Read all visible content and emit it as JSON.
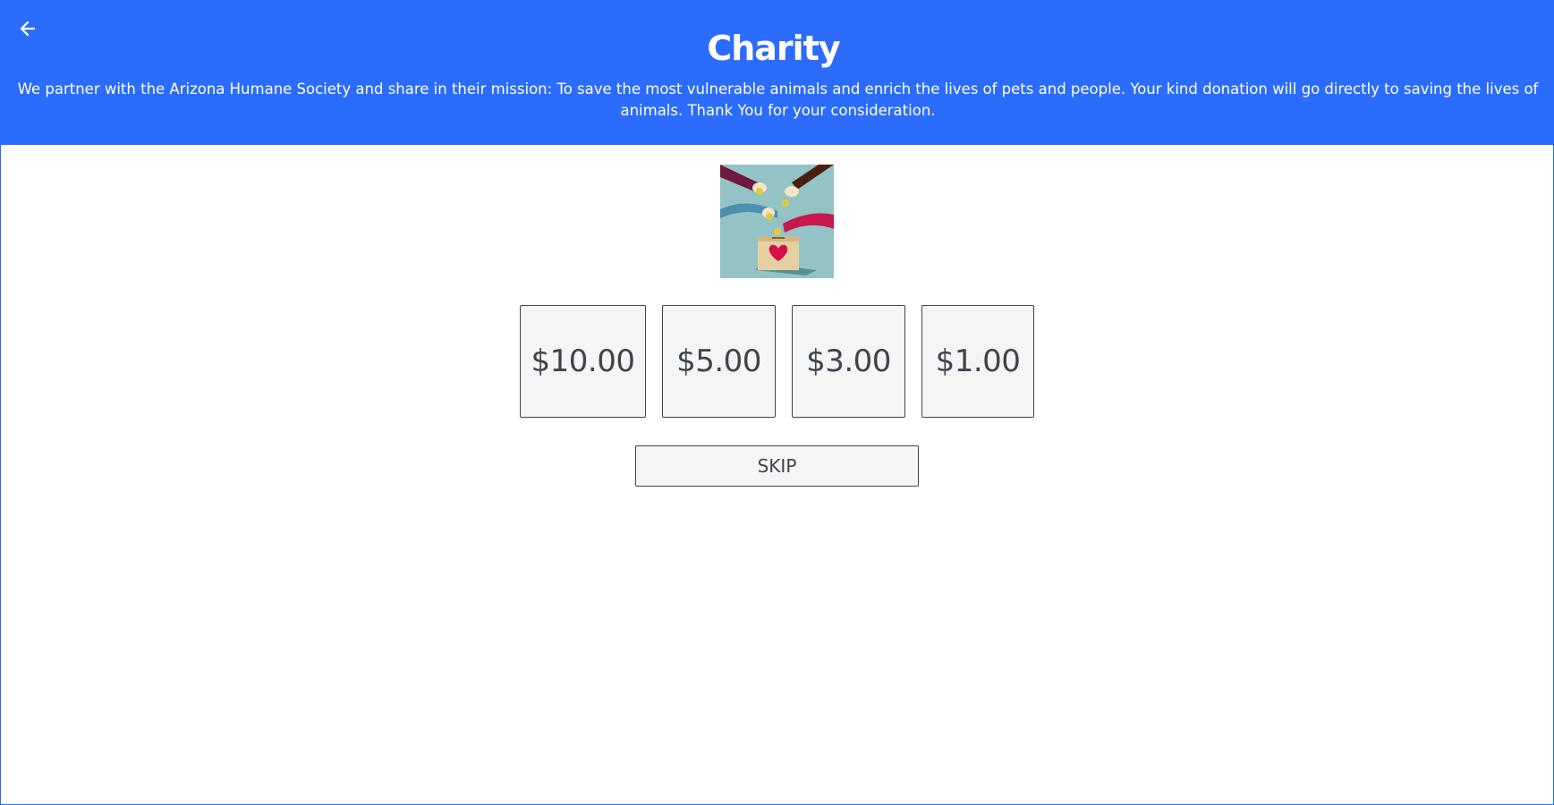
{
  "header": {
    "title": "Charity",
    "back_icon": "arrow-left-icon",
    "description": "We partner with the Arizona Humane Society and share in their mission: To save the most vulnerable animals and enrich the lives of pets and people. Your kind donation will go directly to saving the lives of animals. Thank You for your consideration.",
    "background_color": "#2b6cfd",
    "text_color": "#ffffff"
  },
  "image": {
    "subject": "hands dropping coins into donation box with heart",
    "background_color": "#93c3c5",
    "heart_color": "#d40f4a"
  },
  "donation": {
    "amounts": [
      "$10.00",
      "$5.00",
      "$3.00",
      "$1.00"
    ],
    "skip_label": "SKIP"
  }
}
